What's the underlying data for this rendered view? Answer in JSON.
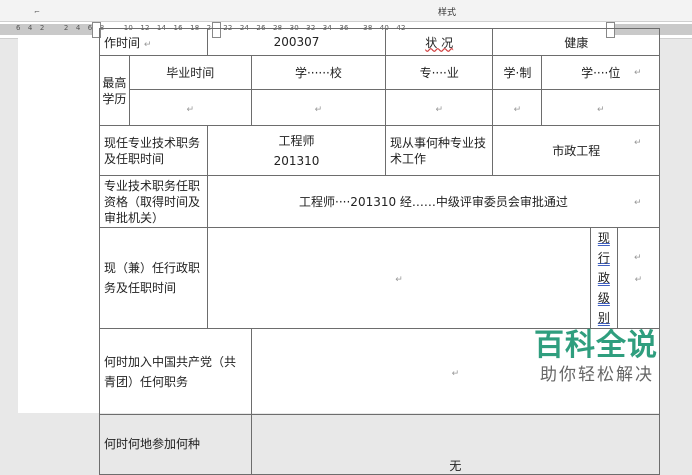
{
  "ribbon": {
    "styles_label": "样式"
  },
  "ruler": {
    "numbers": "6   4   2        2   4   6   8        10   12   14   16   18   20   22   24   26   28   30   32   34   36      38   40   42"
  },
  "form": {
    "row0": {
      "col1": "作时间",
      "col2": "200307",
      "col3": "状  况",
      "col4": "健康"
    },
    "education": {
      "label": "最高学历",
      "headers": [
        "毕业时间",
        "学······校",
        "专····业",
        "学·制",
        "学····位"
      ]
    },
    "title_row": {
      "label": "现任专业技术职务及任职时间",
      "value": "工程师",
      "date": "201310",
      "spec_label": "现从事何种专业技术工作",
      "spec_value": "市政工程"
    },
    "qual_row": {
      "label": "专业技术职务任职资格（取得时间及审批机关）",
      "value": "工程师····201310 经……中级评审委员会审批通过"
    },
    "admin_row": {
      "label": "现（兼）任行政职务及任职时间",
      "level_label": "现行政级别"
    },
    "party_row": {
      "label": "何时加入中国共产党（共青团）任何职务"
    },
    "last_row": {
      "label": "何时何地参加何种",
      "value": "无"
    },
    "para_mark": "↵"
  },
  "watermark": {
    "title": "百科全说",
    "subtitle": "助你轻松解决",
    "color": "#2f9e7e"
  }
}
